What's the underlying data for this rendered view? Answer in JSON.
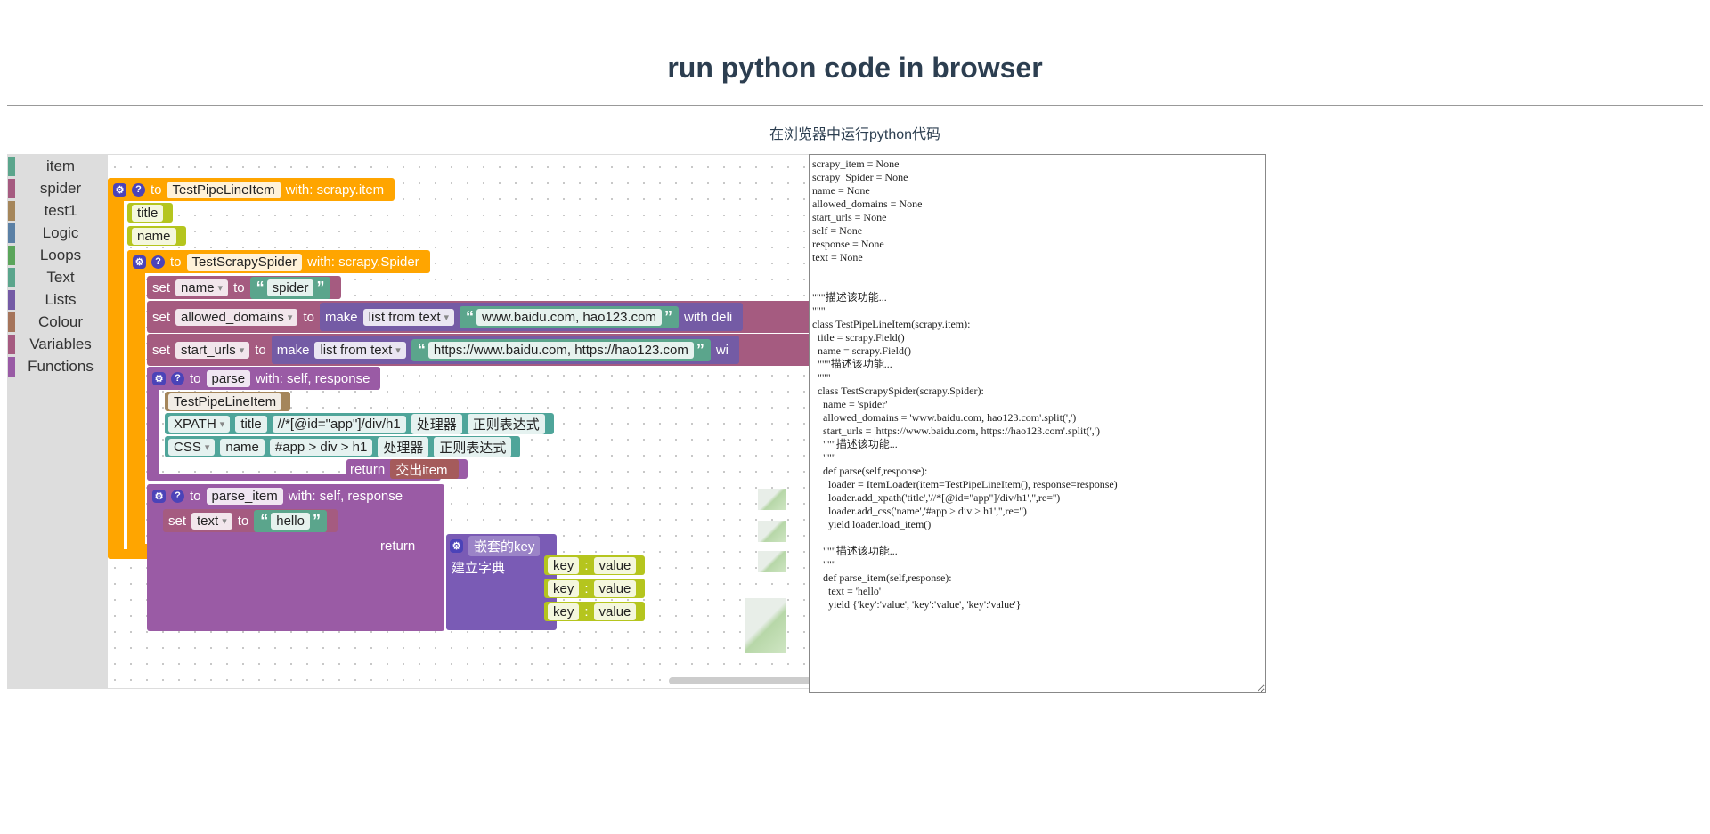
{
  "page": {
    "title": "run python code in browser",
    "subtitle": "在浏览器中运行python代码"
  },
  "toolbox": {
    "categories": [
      {
        "label": "item",
        "color": "#5ba58c"
      },
      {
        "label": "spider",
        "color": "#a55b80"
      },
      {
        "label": "test1",
        "color": "#a5865b"
      },
      {
        "label": "Logic",
        "color": "#5b80a5"
      },
      {
        "label": "Loops",
        "color": "#5ba55b"
      },
      {
        "label": "Text",
        "color": "#5ba58c"
      },
      {
        "label": "Lists",
        "color": "#745ba5"
      },
      {
        "label": "Colour",
        "color": "#a5745b"
      },
      {
        "label": "Variables",
        "color": "#a55b80"
      },
      {
        "label": "Functions",
        "color": "#995ba5"
      }
    ]
  },
  "colors": {
    "procedure": "#ffa500",
    "item_field": "#b5c51e",
    "variable": "#a55b80",
    "text": "#5ba58c",
    "list": "#745ba5",
    "function": "#9a5ba5",
    "selector": "#4fa59a",
    "loader": "#a5865b",
    "yield": "#a55b5b",
    "dict": "#7a5bb5",
    "key_value": "#b5c51e"
  },
  "blocks": {
    "item_proc": {
      "to": "to",
      "name": "TestPipeLineItem",
      "with": "with: scrapy.item",
      "fields": [
        "title",
        "name"
      ]
    },
    "spider_proc": {
      "to": "to",
      "name": "TestScrapySpider",
      "with": "with: scrapy.Spider"
    },
    "set_name": {
      "set": "set",
      "var": "name",
      "to": "to",
      "value": "spider"
    },
    "set_domains": {
      "set": "set",
      "var": "allowed_domains",
      "to": "to",
      "make": "make",
      "mode": "list from text",
      "value": "www.baidu.com, hao123.com",
      "tail": "with deli"
    },
    "set_urls": {
      "set": "set",
      "var": "start_urls",
      "to": "to",
      "make": "make",
      "mode": "list from text",
      "value": "https://www.baidu.com, https://hao123.com",
      "tail": "wi"
    },
    "parse_proc": {
      "to": "to",
      "name": "parse",
      "with": "with: self, response"
    },
    "loader": {
      "item": "TestPipeLineItem"
    },
    "xpath_row": {
      "type": "XPATH",
      "field": "title",
      "expr": "//*[@id=\"app\"]/div/h1",
      "proc": "处理器",
      "regex": "正则表达式"
    },
    "css_row": {
      "type": "CSS",
      "field": "name",
      "expr": "#app > div > h1",
      "proc": "处理器",
      "regex": "正则表达式"
    },
    "parse_return": {
      "return": "return",
      "value": "交出item"
    },
    "parse_item_proc": {
      "to": "to",
      "name": "parse_item",
      "with": "with: self, response"
    },
    "set_text": {
      "set": "set",
      "var": "text",
      "to": "to",
      "value": "hello"
    },
    "parse_item_return": {
      "return": "return"
    },
    "dict": {
      "header": "嵌套的key",
      "label": "建立字典",
      "pairs": [
        {
          "key": "key",
          "sep": ":",
          "value": "value"
        },
        {
          "key": "key",
          "sep": ":",
          "value": "value"
        },
        {
          "key": "key",
          "sep": ":",
          "value": "value"
        }
      ]
    }
  },
  "code_output": "scrapy_item = None\nscrapy_Spider = None\nname = None\nallowed_domains = None\nstart_urls = None\nself = None\nresponse = None\ntext = None\n\n\n\"\"\"描述该功能...\n\"\"\"\nclass TestPipeLineItem(scrapy.item):\n  title = scrapy.Field()\n  name = scrapy.Field()\n  \"\"\"描述该功能...\n  \"\"\"\n  class TestScrapySpider(scrapy.Spider):\n    name = 'spider'\n    allowed_domains = 'www.baidu.com, hao123.com'.split(',')\n    start_urls = 'https://www.baidu.com, https://hao123.com'.split(',')\n    \"\"\"描述该功能...\n    \"\"\"\n    def parse(self,response):\n      loader = ItemLoader(item=TestPipeLineItem(), response=response)\n      loader.add_xpath('title','//*[@id=\"app\"]/div/h1','',re='')\n      loader.add_css('name','#app > div > h1','',re='')\n      yield loader.load_item()\n\n    \"\"\"描述该功能...\n    \"\"\"\n    def parse_item(self,response):\n      text = 'hello'\n      yield {'key':'value', 'key':'value', 'key':'value'}"
}
